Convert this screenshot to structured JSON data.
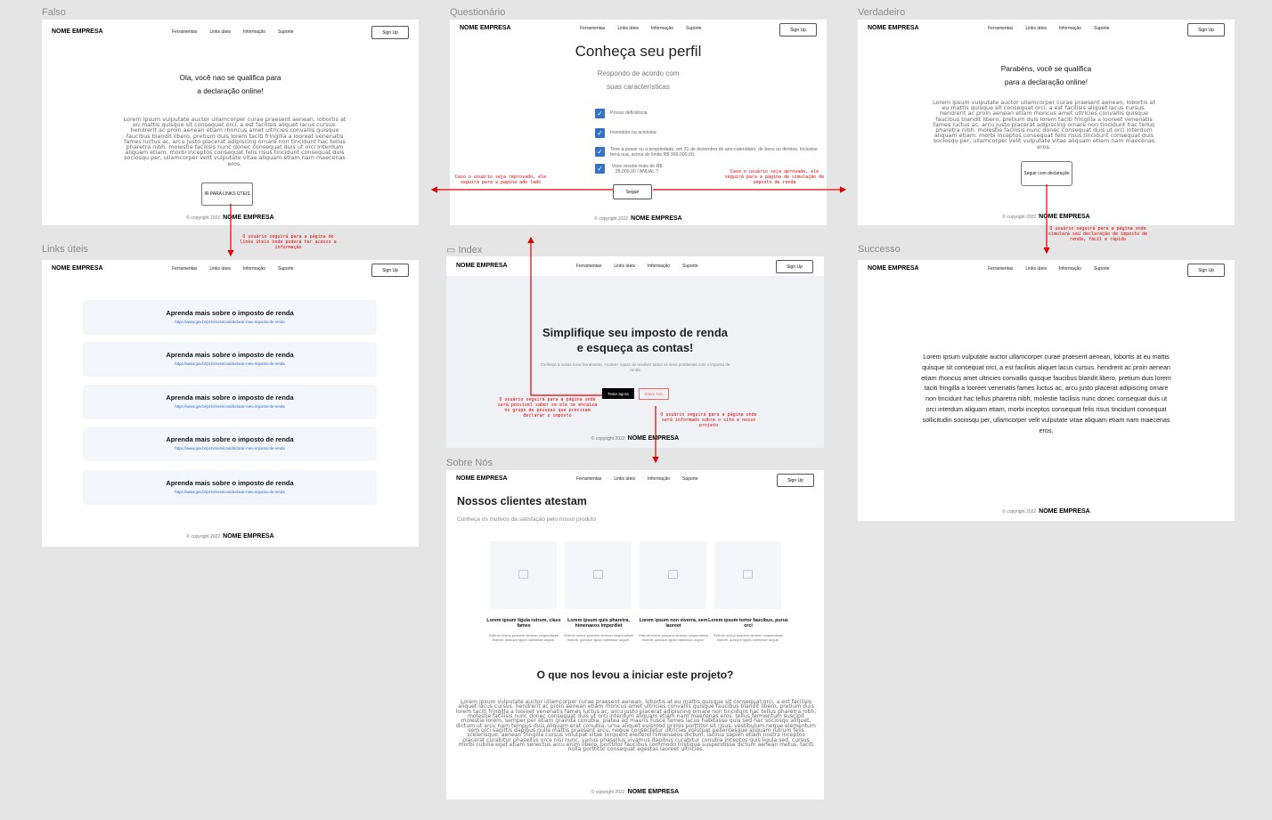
{
  "brand": "NOME EMPRESA",
  "nav": {
    "links": [
      "Ferramentas",
      "Links úteis",
      "Informação",
      "Suporte"
    ],
    "signup": "Sign Up"
  },
  "footer": {
    "copyright": "© copyright 2022"
  },
  "frames": {
    "falso": {
      "label": "Falso",
      "heading_1": "Ola, você nao se qualifica para",
      "heading_2": "a declaração online!",
      "body": "Lorem ipsum vulputate auctor ullamcorper curae praesent aenean, lobortis at eu mattis quisque sit consequat orci, a est facilisis aliquet lacus cursus. hendrerit ac proin aenean etiam rhoncus amet ultricies convallis quisque faucibus blandit libero, pretium duis lorem taciti fringilla a looreet venenatis fames luctus ac, arcu justo placerat adipiscing ornare non tincidunt hac tellus pharetra nibh. molestie facilisis nunc donec consequat duis ut orci interdum aliquam etiam. morbi inceptos consequat felis risus tincidunt consequat duis sociosqu per, ullamcorper velit vulputate vitae aliquam etiam nam maecenas eros.",
      "button": "IR PARA LINKS ÚTEIS"
    },
    "questionario": {
      "label": "Questionário",
      "title": "Conheça seu perfil",
      "subtitle_1": "Respondo de acordo com",
      "subtitle_2": "suas características",
      "checks": [
        "Possui deficiência",
        "Investidor na acionista",
        "Teve a posse ou a propriedade, em 31 de dezembro do ano-calendário, de bens ou direitos, inclusive terra nua, acima do limite R$ 300.000,00;",
        "Voce recebe mais de R$ 28.000,00 / ANUAL ?"
      ],
      "button": "Seguir"
    },
    "verdadeiro": {
      "label": "Verdadeiro",
      "heading_1": "Parabéns, você se qualifica",
      "heading_2": "para a declaração online!",
      "body": "Lorem ipsum vulputate auctor ullamcorper curae praesent aenean, lobortis at eu mattis quisque sit consequat orci, a est facilisis aliquet lacus cursus. hendrerit ac proin aenean etiam rhoncus amet ultricies convallis quisque faucibus blandit libero, pretium duis lorem taciti fringilla a looreet venenatis fames luctus ac, arcu justo placerat adipiscing ornare non tincidunt hac tellus pharetra nibh. molestie facilisis nunc donec consequat duis ut orci interdum aliquam etiam. morbi inceptos consequat felis risus tincidunt consequat duis sociosqu per, ullamcorper velit vulputate vitae aliquam etiam nam maecenas eros.",
      "button": "Seguir com declaração"
    },
    "links": {
      "label": "Links úteis",
      "card_title": "Aprenda mais sobre o imposto de renda",
      "card_url": "https://www.gov.br/pt-br/servicos/declarar-meu-imposto-de-renda"
    },
    "index": {
      "label": "Index",
      "title_1": "Simplifique seu imposto de renda",
      "title_2": "e esqueça as contas!",
      "desc": "Conheça a nossa nova ferramenta, <nome> capaz de resolver todos os seus problemas com o imposto de renda",
      "btn_primary": "Teste agora",
      "btn_secondary": "Sobre Nós"
    },
    "sucesso": {
      "label": "Successo",
      "body": "Lorem ipsum vulputate auctor ullamcorper curae praesent aenean, lobortis at eu mattis quisque sit consequat orci, a est facilisis aliquet lacus cursus. hendrerit ac proin aenean etiam rhoncus amet ultricies convallis quisque faucibus blandit libero, pretium duis lorem taciti fringilla a looreet venenatis fames luctus ac, arcu justo placerat adipiscing ornare non tincidunt hac tellus pharetra nibh, molestie facilisis nunc donec consequat duis ut orci interdum aliquam etiam, morbi inceptos consequat felis risus tincidunt consequat sollicitudin sociosqu per, ullamcorper velit vulputate vitae aliquam etiam nam maecenas eros."
    },
    "sobre": {
      "label": "Sobre Nós",
      "title": "Nossos clientes atestam",
      "subtitle": "Conheça os motivos da satisfação pelo nosso produto",
      "cards": [
        {
          "title": "Lorem ipsum ligula rutrum, class fames",
          "desc": "Rutrum lectus posuere aenean suspendisse blandit, quisque ligula habitasse augue."
        },
        {
          "title": "Lorem ipsum quis pharetra, himenaeos imperdiet",
          "desc": "Rutrum lectus posuere aenean suspendisse blandit, quisque ligula habitasse augue."
        },
        {
          "title": "Lorem ipsum non viverra, sem laoreet",
          "desc": "Rutrum lectus posuere aenean suspendisse blandit, quisque ligula habitasse augue."
        },
        {
          "title": "Lorem ipsum tortor faucibus, purus orci",
          "desc": "Rutrum lectus posuere aenean suspendisse blandit, quisque ligula habitasse augue."
        }
      ],
      "heading2": "O que nos levou a iniciar este projeto?",
      "body": "Lorem ipsum vulputate auctor ullamcorper curae praesent aenean, lobortis at eu mattis quisque sit consequat orci, a est facilisis aliquet lacus cursus. hendrerit ac proin aenean etiam rhoncus amet ultricies convallis quisque faucibus blandit libero, pretium duis lorem taciti fringilla a looreet venenatis fames luctus ac, arcu justo placerat adipiscing ornare non tincidunt hac tellus pharetra nibh. molestie facilisis nunc donec consequat duis ut orci interdum aliquam etiam nam maecenas eros. tellus fermentum suscipit molestie lorem, semper per etiam gravida conubia, platea ad mauris Fusce fames lacus habitasse quis sed hac sociosqu aliquet, dictum ut arcu nam tempus duis aliquam erat conubia, urna aliquet euismod primis porttitor sit risus, vestibulum neque elementum sem orci sagittis dapibus nulla mattis praesent arcu, neque consectetur ultricies volutpat pellentesque aliquam rutrum felis scelerisque, aenean fringilla cursus volutpat vitae torquent eleifend himenaeos dictum. lacinia sapien etiam nostra inceptos placerat curabitur phasellus orca nisi nunc, varius phasellus vivamus dapibus curabitur conubia inceptos quis ligula sed. cursus morbi cubilia eget etiam senectus arcu enim libero, porttitor faucibus commodo tristique suspendisse dictum aenean metus, taciti nulla porttitor consequat egestas laoreet ultricies."
    }
  },
  "notes": {
    "left": "Caso o usuário seja reprovado, ele seguirá para a pagina ado lado",
    "right": "Caso o usuário seja aprovado, ele seguirá para a página de simulação de imposto de renda",
    "links": "O usuário seguirá para a página de links úteis onde poderá ter acesso a informação",
    "verdadeiro": "O usuário seguirá para a página onde simulará seu declaração de imposto de renda, fácil e rápido",
    "index_left": "O usuário seguirá para a página onde será possível saber se ele se encaixa no grupo de pessoas que precisam declarar o imposto",
    "index_right": "O usuário seguirá para a página onde será informado sobre o site e nosso projeto"
  },
  "colors": {
    "arrow": "#e00000",
    "checkbox": "#3572c4",
    "link": "#3366cc"
  }
}
